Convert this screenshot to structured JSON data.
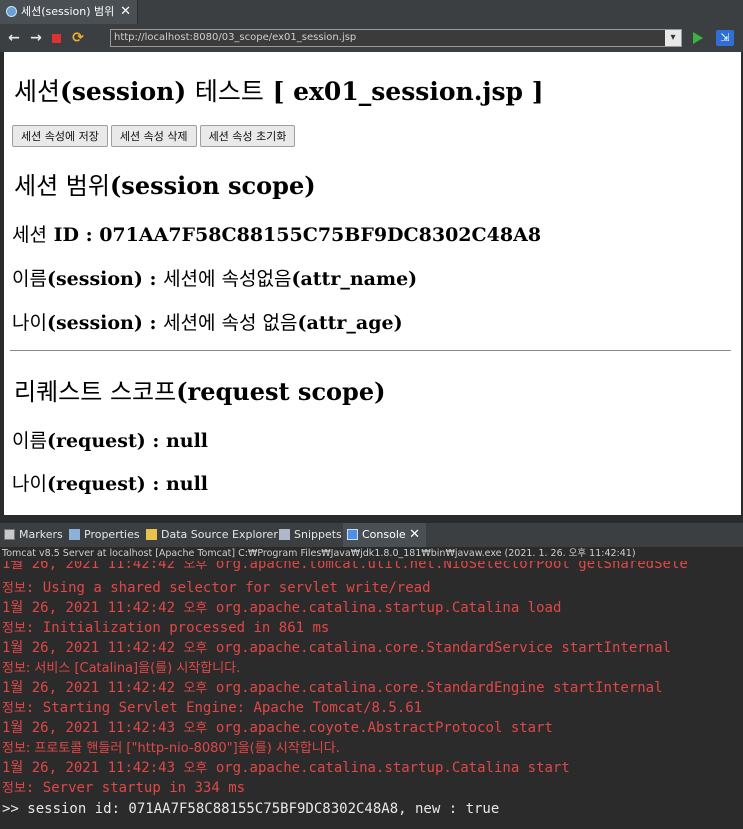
{
  "editor_tab": {
    "label": "세션(session) 범위",
    "close": "✕"
  },
  "toolbar": {
    "url": "http://localhost:8080/03_scope/ex01_session.jsp",
    "icons": {
      "back": "←",
      "forward": "→",
      "refresh": "⟳",
      "dropdown": "▾",
      "external": "⇲"
    }
  },
  "page": {
    "title_kr": "세션",
    "title_rest": "(session) ",
    "title_kr2": "테스트",
    "title_rest2": " [ ex01_session.jsp ]",
    "buttons": [
      "세션 속성에 저장",
      "세션 속성 삭제",
      "세션 속성 초기화"
    ],
    "session_heading_kr": "세션 범위",
    "session_heading_rest": "(session scope)",
    "session_id_kr": "세션",
    "session_id_rest": " ID : 071AA7F58C88155C75BF9DC8302C48A8",
    "name_session_kr": "이름",
    "name_session_mid": "(session) : ",
    "name_session_kr2": "세션에 속성없음",
    "name_session_rest": "(attr_name)",
    "age_session_kr": "나이",
    "age_session_mid": "(session) : ",
    "age_session_kr2": "세션에 속성 없음",
    "age_session_rest": "(attr_age)",
    "request_heading_kr": "리퀘스트 스코프",
    "request_heading_rest": "(request scope)",
    "name_request_kr": "이름",
    "name_request_rest": "(request) : null",
    "age_request_kr": "나이",
    "age_request_rest": "(request) : null"
  },
  "views": {
    "tabs": [
      "Markers",
      "Properties",
      "Data Source Explorer",
      "Snippets",
      "Console"
    ],
    "console_close": "✕"
  },
  "console": {
    "header": "Tomcat v8.5 Server at localhost [Apache Tomcat] C:₩Program Files₩Java₩jdk1.8.0_181₩bin₩javaw.exe (2021. 1. 26. 오후 11:42:41)",
    "lines": [
      {
        "a": "1월 26, 2021 11:42:42 ",
        "k": "오후",
        "b": " org.apache.tomcat.util.net.NioSelectorPool getSharedSele"
      },
      {
        "a": "",
        "k": "정보",
        "b": ": Using a shared selector for servlet write/read"
      },
      {
        "a": "1월 26, 2021 11:42:42 ",
        "k": "오후",
        "b": " org.apache.catalina.startup.Catalina load"
      },
      {
        "a": "",
        "k": "정보",
        "b": ": Initialization processed in 861 ms"
      },
      {
        "a": "1월 26, 2021 11:42:42 ",
        "k": "오후",
        "b": " org.apache.catalina.core.StandardService startInternal"
      },
      {
        "a": "",
        "k": "정보: 서비스 [Catalina]을(를) 시작합니다.",
        "b": ""
      },
      {
        "a": "1월 26, 2021 11:42:42 ",
        "k": "오후",
        "b": " org.apache.catalina.core.StandardEngine startInternal"
      },
      {
        "a": "",
        "k": "정보",
        "b": ": Starting Servlet Engine: Apache Tomcat/8.5.61"
      },
      {
        "a": "1월 26, 2021 11:42:43 ",
        "k": "오후",
        "b": " org.apache.coyote.AbstractProtocol start"
      },
      {
        "a": "",
        "k": "정보: 프로토콜 핸들러 [\"http-nio-8080\"]을(를) 시작합니다.",
        "b": ""
      },
      {
        "a": "1월 26, 2021 11:42:43 ",
        "k": "오후",
        "b": " org.apache.catalina.startup.Catalina start"
      },
      {
        "a": "",
        "k": "정보",
        "b": ": Server startup in 334 ms"
      }
    ],
    "output": ">> session id: 071AA7F58C88155C75BF9DC8302C48A8, new : true"
  }
}
